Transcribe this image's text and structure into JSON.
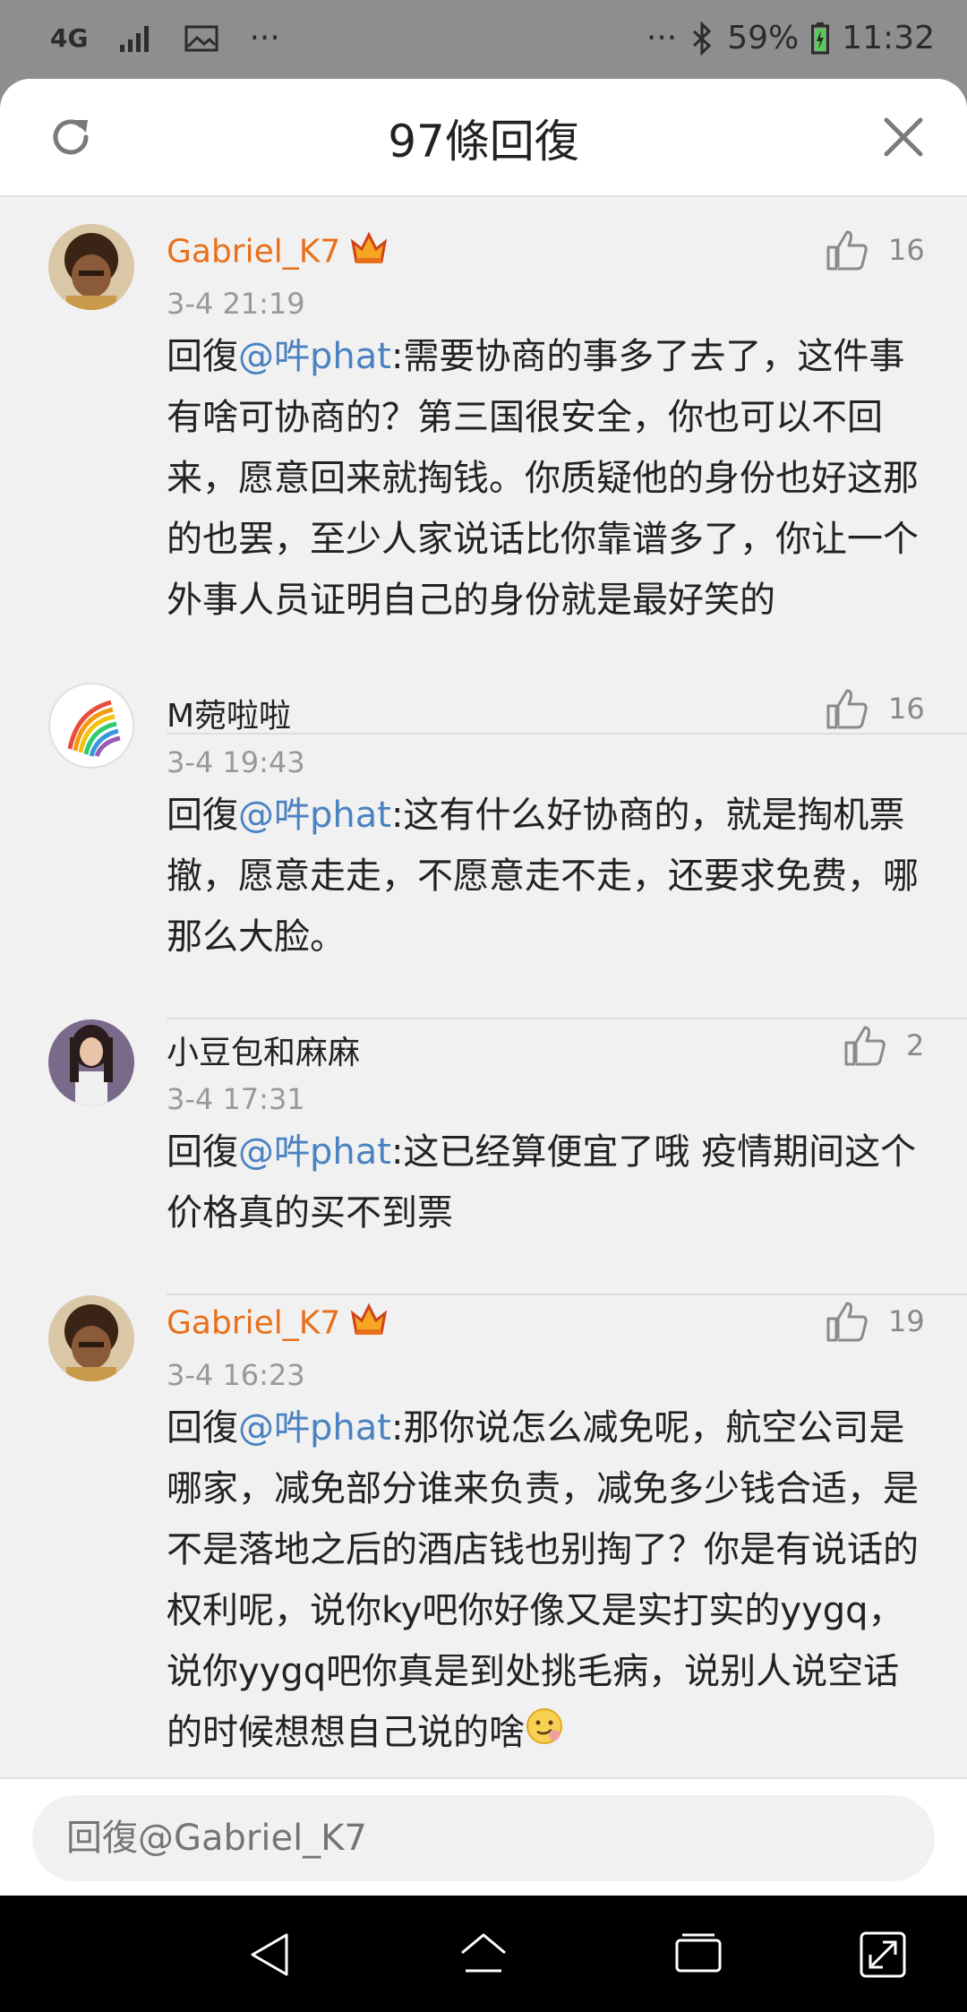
{
  "status_bar": {
    "network": "4G",
    "more_left": "···",
    "more_right": "···",
    "battery": "59%",
    "time": "11:32"
  },
  "header": {
    "title": "97條回復"
  },
  "comments": [
    {
      "user": "Gabriel_K7",
      "vip": true,
      "time": "3-4 21:19",
      "likes": "16",
      "reply_prefix": "回復",
      "mention": "@吽phat",
      "text": ":需要协商的事多了去了，这件事有啥可协商的？第三国很安全，你也可以不回来，愿意回来就掏钱。你质疑他的身份也好这那的也罢，至少人家说话比你靠谱多了，你让一个外事人员证明自己的身份就是最好笑的"
    },
    {
      "user": "M菀啦啦",
      "vip": false,
      "time": "3-4 19:43",
      "likes": "16",
      "reply_prefix": "回復",
      "mention": "@吽phat",
      "text": ":这有什么好协商的，就是掏机票撤，愿意走走，不愿意走不走，还要求免费，哪那么大脸。"
    },
    {
      "user": "小豆包和麻麻",
      "vip": false,
      "time": "3-4 17:31",
      "likes": "2",
      "reply_prefix": "回復",
      "mention": "@吽phat",
      "text": ":这已经算便宜了哦 疫情期间这个价格真的买不到票"
    },
    {
      "user": "Gabriel_K7",
      "vip": true,
      "time": "3-4 16:23",
      "likes": "19",
      "reply_prefix": "回復",
      "mention": "@吽phat",
      "text": ":那你说怎么减免呢，航空公司是哪家，减免部分谁来负责，减免多少钱合适，是不是落地之后的酒店钱也别掏了？你是有说话的权利呢，说你ky吧你好像又是实打实的yygq，说你yygq吧你真是到处挑毛病，说别人说空话的时候想想自己说的啥"
    }
  ],
  "reply_bar": {
    "placeholder": "回復@Gabriel_K7"
  },
  "icons": {
    "refresh": "refresh-icon",
    "close": "close-icon",
    "like": "thumbs-up-icon",
    "crown": "vip-crown-icon",
    "emoji": "smirk-emoji-icon"
  },
  "colors": {
    "vip_name": "#e8701a",
    "mention": "#4a82c2",
    "time": "#999999"
  }
}
